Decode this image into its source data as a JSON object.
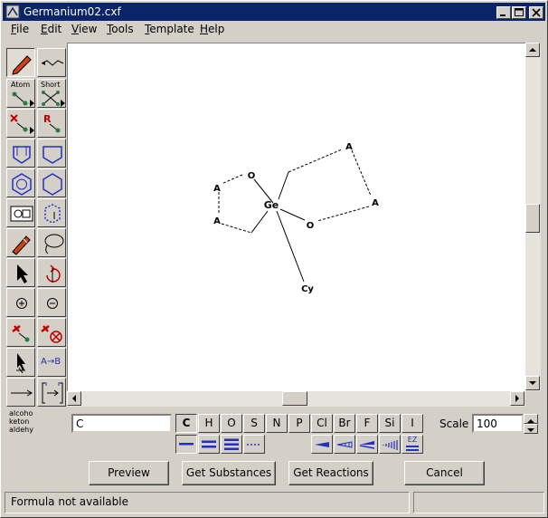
{
  "window": {
    "title": "Germanium02.cxf"
  },
  "menu": {
    "items": [
      {
        "label": "File",
        "accel": "F",
        "rest": "ile"
      },
      {
        "label": "Edit",
        "accel": "E",
        "rest": "dit"
      },
      {
        "label": "View",
        "accel": "V",
        "rest": "iew"
      },
      {
        "label": "Tools",
        "accel": "T",
        "rest": "ools"
      },
      {
        "label": "Template",
        "accel": "T",
        "rest": "emplate"
      },
      {
        "label": "Help",
        "accel": "H",
        "rest": "elp"
      }
    ]
  },
  "toolbar": {
    "atom_label": "Atom",
    "short_label": "Short",
    "r_label": "R",
    "arrow_text": "A→B",
    "functional_groups": [
      "alcohol",
      "ketone",
      "aldehyde"
    ],
    "functional_groups_display": [
      "alcoho",
      "keton",
      "aldehy"
    ]
  },
  "molecule": {
    "atoms": [
      {
        "id": "ge",
        "label": "Ge"
      },
      {
        "id": "o1",
        "label": "O"
      },
      {
        "id": "o2",
        "label": "O"
      },
      {
        "id": "a1",
        "label": "A"
      },
      {
        "id": "a2",
        "label": "A"
      },
      {
        "id": "a3",
        "label": "A"
      },
      {
        "id": "a4",
        "label": "A"
      },
      {
        "id": "cy",
        "label": "Cy"
      }
    ]
  },
  "atom_input": {
    "value": "C"
  },
  "elements": [
    "C",
    "H",
    "O",
    "S",
    "N",
    "P",
    "Cl",
    "Br",
    "F",
    "Si",
    "I"
  ],
  "selected_element": "C",
  "bond_tools": {
    "ez_label": "EZ"
  },
  "scale": {
    "label": "Scale",
    "value": "100"
  },
  "buttons": {
    "preview": "Preview",
    "get_substances": "Get Substances",
    "get_reactions": "Get Reactions",
    "cancel": "Cancel"
  },
  "status": {
    "message": "Formula not available",
    "secondary": ""
  }
}
